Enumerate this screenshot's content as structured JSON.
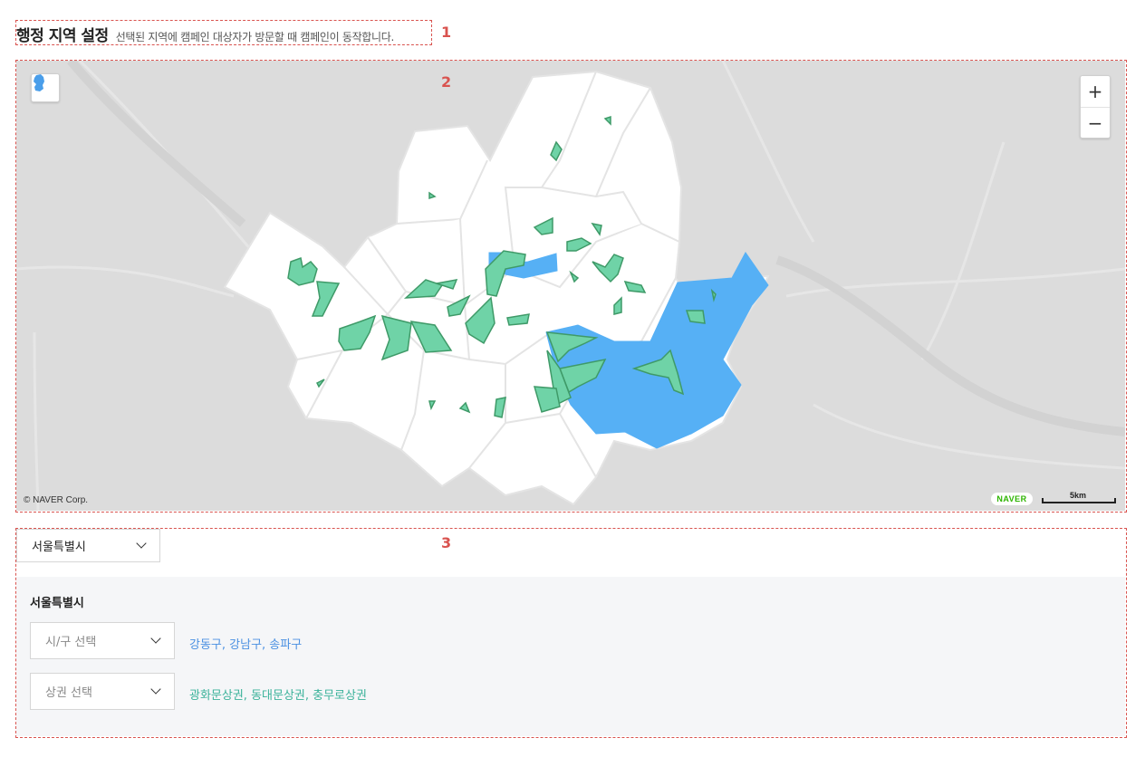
{
  "header": {
    "title": "행정 지역 설정",
    "description": "선택된 지역에 캠페인 대상자가 방문할 때 캠페인이 동작합니다."
  },
  "markers": [
    "1",
    "2",
    "3"
  ],
  "map": {
    "copyright": "© NAVER Corp.",
    "logo": "NAVER",
    "scale_label": "5km",
    "zoom_in_label": "+",
    "zoom_out_label": "−",
    "region_toggle_icon": "korea-map-icon",
    "colors": {
      "background": "#dcdcdc",
      "district_fill": "#ffffff",
      "selected_district": "#56b0f5",
      "commercial_area": "#6fd3a7",
      "commercial_area_stroke": "#3f9a68"
    }
  },
  "filter": {
    "region_select_value": "서울특별시",
    "panel_heading": "서울특별시",
    "district_select_placeholder": "시/구 선택",
    "district_selected_text": "강동구, 강남구, 송파구",
    "area_select_placeholder": "상권 선택",
    "area_selected_text": "광화문상권, 동대문상권, 충무로상권"
  }
}
